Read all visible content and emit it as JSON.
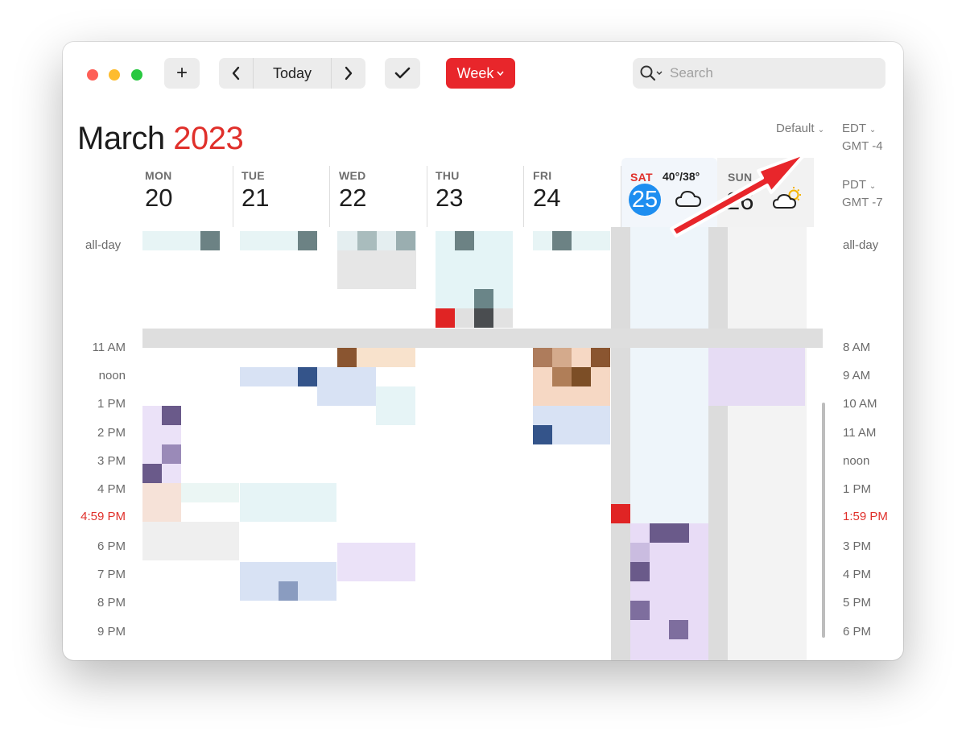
{
  "toolbar": {
    "add_label": "+",
    "today_label": "Today",
    "view_label": "Week",
    "search_placeholder": "Search"
  },
  "header": {
    "month": "March",
    "year": "2023",
    "calendar_set": "Default",
    "tz1_name": "EDT",
    "tz1_offset": "GMT -4",
    "tz2_name": "PDT",
    "tz2_offset": "GMT -7"
  },
  "days": [
    {
      "name": "MON",
      "num": "20"
    },
    {
      "name": "TUE",
      "num": "21"
    },
    {
      "name": "WED",
      "num": "22"
    },
    {
      "name": "THU",
      "num": "23"
    },
    {
      "name": "FRI",
      "num": "24"
    },
    {
      "name": "SAT",
      "num": "25",
      "weather": "40°/38°"
    },
    {
      "name": "SUN",
      "num": "26"
    }
  ],
  "allday_label": "all-day",
  "times_left": [
    "11 AM",
    "noon",
    "1 PM",
    "2 PM",
    "3 PM",
    "4 PM",
    "4:59 PM",
    "6 PM",
    "7 PM",
    "8 PM",
    "9 PM"
  ],
  "times_right": [
    "8 AM",
    "9 AM",
    "10 AM",
    "11 AM",
    "noon",
    "1 PM",
    "1:59 PM",
    "3 PM",
    "4 PM",
    "5 PM",
    "6 PM"
  ],
  "colors": {
    "accent_red": "#e8262b",
    "today_blue": "#1e8ef0",
    "now_red": "#e0302b"
  },
  "icons": {
    "cloud": "cloud-icon",
    "partly_sunny": "partly-sunny-icon",
    "annotation": "red-arrow-annotation"
  }
}
